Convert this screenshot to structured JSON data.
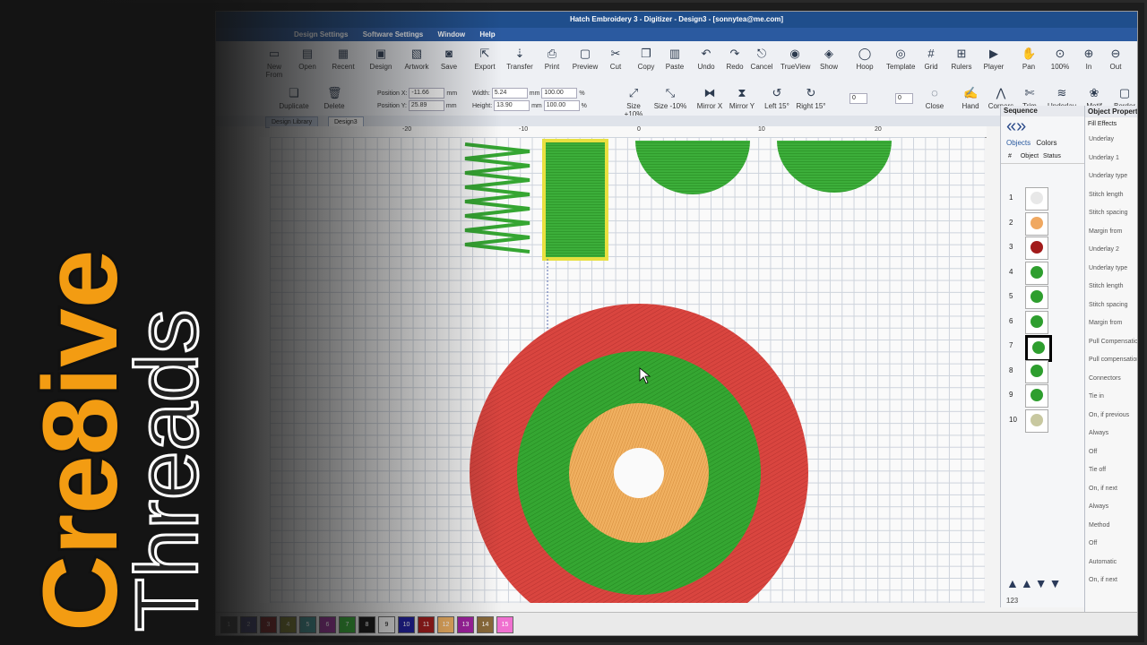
{
  "window": {
    "title": "Hatch Embroidery 3 - Digitizer - Design3 - [sonnytea@me.com]"
  },
  "menu": [
    "Design Settings",
    "Software Settings",
    "Window",
    "Help"
  ],
  "toolbar1": [
    {
      "label": "New From",
      "icon": "new-from-icon",
      "glyph": "▭"
    },
    {
      "label": "Open",
      "icon": "open-icon",
      "glyph": "▤"
    },
    {
      "label": "Recent",
      "icon": "recent-icon",
      "glyph": "▦"
    },
    {
      "label": "Design",
      "icon": "design-icon",
      "glyph": "▣"
    },
    {
      "label": "Artwork",
      "icon": "artwork-icon",
      "glyph": "▧"
    },
    {
      "label": "Save",
      "icon": "save-icon",
      "glyph": "◙"
    },
    {
      "label": "Export",
      "icon": "export-icon",
      "glyph": "⇱"
    },
    {
      "label": "Transfer",
      "icon": "transfer-icon",
      "glyph": "⇣"
    },
    {
      "label": "Print",
      "icon": "print-icon",
      "glyph": "⎙"
    },
    {
      "label": "Preview",
      "icon": "preview-icon",
      "glyph": "▢"
    },
    {
      "label": "Cut",
      "icon": "cut-icon",
      "glyph": "✂"
    },
    {
      "label": "Copy",
      "icon": "copy-icon",
      "glyph": "❐"
    },
    {
      "label": "Paste",
      "icon": "paste-icon",
      "glyph": "▥"
    },
    {
      "label": "Undo",
      "icon": "undo-icon",
      "glyph": "↶"
    },
    {
      "label": "Redo",
      "icon": "redo-icon",
      "glyph": "↷"
    },
    {
      "label": "Cancel",
      "icon": "cancel-icon",
      "glyph": "⎋"
    },
    {
      "label": "TrueView",
      "icon": "trueview-icon",
      "glyph": "◉"
    },
    {
      "label": "Show",
      "icon": "show-icon",
      "glyph": "◈"
    },
    {
      "label": "Hoop",
      "icon": "hoop-icon",
      "glyph": "◯"
    },
    {
      "label": "Template",
      "icon": "template-icon",
      "glyph": "◎"
    },
    {
      "label": "Grid",
      "icon": "grid-icon",
      "glyph": "#"
    },
    {
      "label": "Rulers",
      "icon": "rulers-icon",
      "glyph": "⊞"
    },
    {
      "label": "Player",
      "icon": "player-icon",
      "glyph": "▶"
    },
    {
      "label": "Pan",
      "icon": "pan-icon",
      "glyph": "✋"
    },
    {
      "label": "100%",
      "icon": "zoom-100-icon",
      "glyph": "⊙"
    },
    {
      "label": "In",
      "icon": "zoom-in-icon",
      "glyph": "⊕"
    },
    {
      "label": "Out",
      "icon": "zoom-out-icon",
      "glyph": "⊖"
    }
  ],
  "toolbar2": [
    {
      "label": "Duplicate",
      "icon": "duplicate-icon",
      "glyph": "❏"
    },
    {
      "label": "Delete",
      "icon": "delete-icon",
      "glyph": "🗑"
    },
    {
      "label": "Size +10%",
      "icon": "size-plus-icon",
      "glyph": "⤢"
    },
    {
      "label": "Size -10%",
      "icon": "size-minus-icon",
      "glyph": "⤡"
    },
    {
      "label": "Mirror X",
      "icon": "mirror-x-icon",
      "glyph": "⧓"
    },
    {
      "label": "Mirror Y",
      "icon": "mirror-y-icon",
      "glyph": "⧗"
    },
    {
      "label": "Left 15°",
      "icon": "rotate-left-icon",
      "glyph": "↺"
    },
    {
      "label": "Right 15°",
      "icon": "rotate-right-icon",
      "glyph": "↻"
    },
    {
      "label": "Close",
      "icon": "close-shape-icon",
      "glyph": "◌"
    },
    {
      "label": "Hand",
      "icon": "hand-icon",
      "glyph": "✍"
    },
    {
      "label": "Corners",
      "icon": "corners-icon",
      "glyph": "⋀"
    },
    {
      "label": "Trim",
      "icon": "trim-icon",
      "glyph": "✄"
    },
    {
      "label": "Underlay",
      "icon": "underlay-icon",
      "glyph": "≋"
    },
    {
      "label": "Motif",
      "icon": "motif-icon",
      "glyph": "❀"
    },
    {
      "label": "Border",
      "icon": "border-icon",
      "glyph": "▢"
    }
  ],
  "position": {
    "x_label": "Position X:",
    "x": "-11.66",
    "y_label": "Position Y:",
    "y": "25.89",
    "unit": "mm"
  },
  "size": {
    "w_label": "Width:",
    "w": "5.24",
    "h_label": "Height:",
    "h": "13.90",
    "unit": "mm",
    "wpct": "100.00",
    "hpct": "100.00",
    "pct": "%"
  },
  "rotate_value": "0",
  "slant_value": "0",
  "tabs": [
    "Design Library",
    "Design3"
  ],
  "ruler_ticks": [
    "-20",
    "-10",
    "0",
    "10",
    "20"
  ],
  "sequence": {
    "title": "Sequence",
    "tabs": [
      "Objects",
      "Colors"
    ],
    "columns": [
      "#",
      "Object",
      "Status"
    ],
    "rows": [
      {
        "n": "1",
        "color": "#e8e8e8"
      },
      {
        "n": "2",
        "color": "#f0a860"
      },
      {
        "n": "3",
        "color": "#a21b1b"
      },
      {
        "n": "4",
        "color": "#2e9e2e"
      },
      {
        "n": "5",
        "color": "#2e9e2e"
      },
      {
        "n": "6",
        "color": "#2e9e2e"
      },
      {
        "n": "7",
        "color": "#2e9e2e"
      },
      {
        "n": "8",
        "color": "#2e9e2e"
      },
      {
        "n": "9",
        "color": "#2e9e2e"
      },
      {
        "n": "10",
        "color": "#c8c8a0"
      }
    ],
    "footer": "123"
  },
  "properties": {
    "title": "Object Properties",
    "tabs": [
      "Fill",
      "Effects"
    ],
    "items": [
      "Underlay",
      "Underlay 1",
      "Underlay type",
      "Stitch length",
      "Stitch spacing",
      "Margin from",
      "Underlay 2",
      "Underlay type",
      "Stitch length",
      "Stitch spacing",
      "Margin from",
      "Pull Compensation",
      "Pull compensation",
      "Connectors",
      "Tie in",
      "On, if previous",
      "Always",
      "Off",
      "Tie off",
      "On, if next",
      "Always",
      "Method",
      "Off",
      "Automatic",
      "On, if next"
    ]
  },
  "palette": [
    {
      "n": "1",
      "c": "#555555"
    },
    {
      "n": "2",
      "c": "#4a4a8a"
    },
    {
      "n": "3",
      "c": "#8a2020"
    },
    {
      "n": "4",
      "c": "#7a7a2a"
    },
    {
      "n": "5",
      "c": "#3a8a8a"
    },
    {
      "n": "6",
      "c": "#8a2a8a"
    },
    {
      "n": "7",
      "c": "#2e9e2e"
    },
    {
      "n": "8",
      "c": "#111111"
    },
    {
      "n": "9",
      "c": "#f5f5f5"
    },
    {
      "n": "10",
      "c": "#1a1a9a"
    },
    {
      "n": "11",
      "c": "#a01818"
    },
    {
      "n": "12",
      "c": "#f0b060"
    },
    {
      "n": "13",
      "c": "#a020a0"
    },
    {
      "n": "14",
      "c": "#8a6a3a"
    },
    {
      "n": "15",
      "c": "#f070d0"
    }
  ],
  "logo": {
    "line1": "Cre8ive",
    "line2": "Threads"
  },
  "colors": {
    "red": "#d9453f",
    "green": "#35a632",
    "orange": "#f0b060",
    "brand": "#f39c12"
  }
}
